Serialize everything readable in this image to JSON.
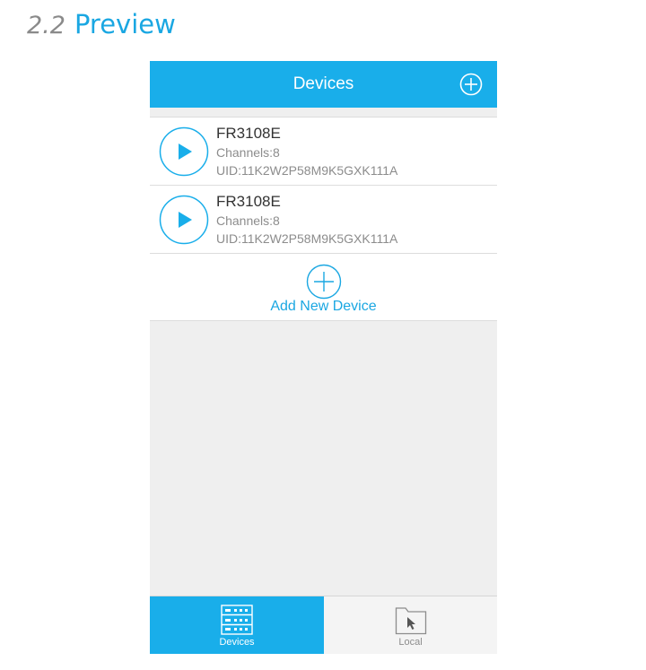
{
  "section": {
    "number": "2.2",
    "title": "Preview"
  },
  "header": {
    "title": "Devices",
    "add_icon": "plus-circle-icon"
  },
  "devices": [
    {
      "name": "FR3108E",
      "channels": "Channels:8",
      "uid": "UID:11K2W2P58M9K5GXK111A",
      "icon": "play-icon"
    },
    {
      "name": "FR3108E",
      "channels": "Channels:8",
      "uid": "UID:11K2W2P58M9K5GXK111A",
      "icon": "play-icon"
    }
  ],
  "add_device": {
    "label": "Add New Device",
    "icon": "plus-circle-icon"
  },
  "tabs": [
    {
      "label": "Devices",
      "icon": "server-rack-icon",
      "active": true
    },
    {
      "label": "Local",
      "icon": "folder-cursor-icon",
      "active": false
    }
  ],
  "colors": {
    "accent": "#19aeea",
    "heading_blue": "#1aa7e2",
    "background": "#efefef",
    "text_dark": "#333333",
    "text_gray": "#8c8c8c"
  }
}
